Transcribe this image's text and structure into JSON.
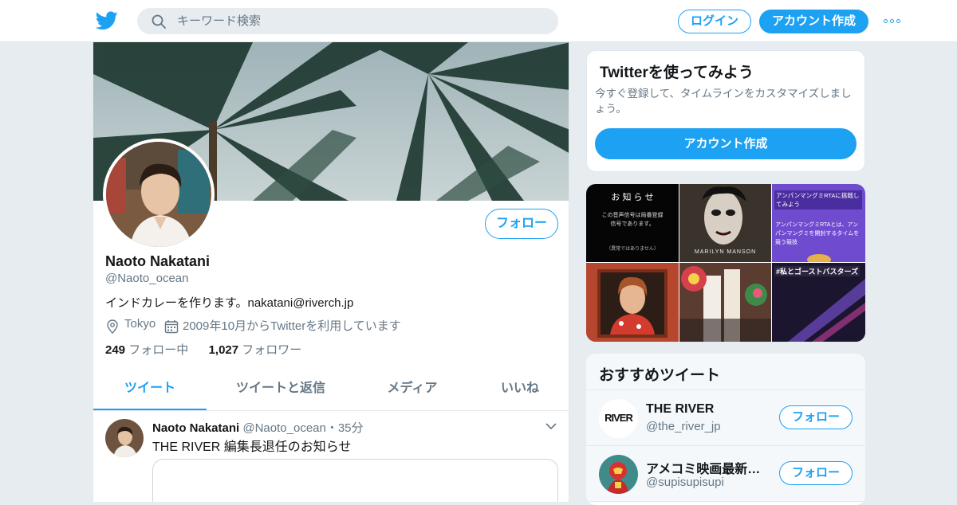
{
  "header": {
    "logo_icon": "twitter-bird-icon",
    "search_placeholder": "キーワード検索",
    "login_label": "ログイン",
    "signup_label": "アカウント作成",
    "more_icon": "more-dots-icon"
  },
  "profile": {
    "name": "Naoto Nakatani",
    "handle": "@Naoto_ocean",
    "bio": "インドカレーを作ります。nakatani@riverch.jp",
    "location": "Tokyo",
    "joined": "2009年10月からTwitterを利用しています",
    "following_count": "249",
    "following_label": "フォロー中",
    "followers_count": "1,027",
    "followers_label": "フォロワー",
    "follow_label": "フォロー"
  },
  "tabs": [
    {
      "label": "ツイート"
    },
    {
      "label": "ツイートと返信"
    },
    {
      "label": "メディア"
    },
    {
      "label": "いいね"
    }
  ],
  "tweet": {
    "author": "Naoto Nakatani",
    "handle": "@Naoto_ocean",
    "time": "・35分",
    "text": "THE RIVER 編集長退任のお知らせ"
  },
  "side": {
    "title": "Twitterを使ってみよう",
    "desc": "今すぐ登録して、タイムラインをカスタマイズしましょう。",
    "button": "アカウント作成"
  },
  "media": {
    "m1": {
      "title": "お 知 ら せ",
      "body": "この音声信号は局番登録\n信号であります。",
      "foot": "（異常ではありません）"
    },
    "m2": {
      "label": "MARILYN MANSON"
    },
    "m3": {
      "title": "アンパンマングミRTAに挑戦してみよう",
      "body": "アンパンマングミRTAとは、アンパンマングミを開封するタイムを競う競技"
    },
    "m6": {
      "title": "#私とゴーストバスターズ"
    }
  },
  "recommended": {
    "title": "おすすめツイート",
    "follow_label": "フォロー",
    "accounts": [
      {
        "name": "THE RIVER",
        "handle": "@the_river_jp",
        "logo_text": "RIVER"
      },
      {
        "name": "アメコミ映画最新情報",
        "handle": "@supisupisupi"
      }
    ]
  },
  "colors": {
    "accent": "#1da1f2",
    "text": "#14171a",
    "muted": "#657786",
    "background": "#e6ecf0"
  }
}
